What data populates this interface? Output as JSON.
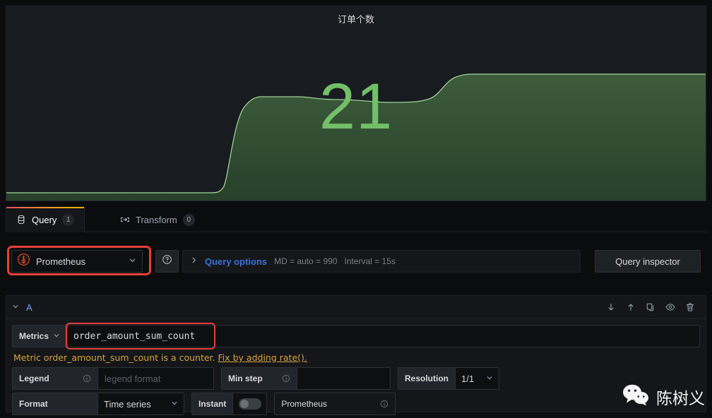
{
  "panel": {
    "title": "订单个数",
    "stat_value": "21",
    "value_color": "#73bf69",
    "line_color": "#8fd48a",
    "fill_color": "#2d4a2c"
  },
  "chart_data": {
    "type": "area",
    "title": "订单个数",
    "xlabel": "",
    "ylabel": "",
    "grid": false,
    "legend": "none",
    "x": [
      0,
      5,
      10,
      15,
      20,
      25,
      29,
      31,
      33,
      35,
      40,
      45,
      50,
      55,
      58,
      60,
      62,
      64,
      66,
      70,
      75,
      80,
      85,
      90,
      95,
      100
    ],
    "values": [
      1,
      1,
      1,
      1,
      1,
      1,
      1,
      3,
      9,
      14,
      15,
      15,
      15,
      15,
      14.6,
      14.4,
      15,
      18,
      21,
      21,
      21,
      21,
      21,
      21,
      21,
      21
    ],
    "ylim": [
      0,
      24
    ],
    "annotations": [
      "21"
    ]
  },
  "tabs": [
    {
      "label": "Query",
      "badge": "1",
      "icon": "database-icon",
      "active": true
    },
    {
      "label": "Transform",
      "badge": "0",
      "icon": "transform-icon",
      "active": false
    }
  ],
  "datasource": {
    "name": "Prometheus",
    "icon": "prometheus-icon",
    "highlighted": true,
    "highlight_color": "#e8403a",
    "help_icon": "question-circle-icon"
  },
  "query_options": {
    "chevron": "chevron-right-icon",
    "title": "Query options",
    "max_data_points": "MD = auto = 990",
    "interval": "Interval = 15s"
  },
  "query_inspector": {
    "label": "Query inspector"
  },
  "query_row": {
    "ref_id": "A",
    "collapse_icon": "chevron-down-icon",
    "actions": [
      {
        "name": "move-down-icon",
        "glyph": "↓"
      },
      {
        "name": "move-up-icon",
        "glyph": "↑"
      },
      {
        "name": "duplicate-icon",
        "glyph": "copy"
      },
      {
        "name": "hide-response-icon",
        "glyph": "eye"
      },
      {
        "name": "remove-query-icon",
        "glyph": "trash"
      }
    ]
  },
  "metrics_row": {
    "label": "Metrics",
    "value": "order_amount_sum_count",
    "highlighted": true
  },
  "warning": {
    "text": "Metric order_amount_sum_count is a counter.",
    "link": "Fix by adding rate().",
    "color": "#d9a441"
  },
  "legend_row": {
    "legend_label": "Legend",
    "legend_placeholder": "legend format",
    "legend_value": "",
    "min_step_label": "Min step",
    "min_step_value": "",
    "resolution_label": "Resolution",
    "resolution_value": "1/1"
  },
  "format_row": {
    "format_label": "Format",
    "format_value": "Time series",
    "instant_label": "Instant",
    "instant_on": false,
    "exemplars_label": "Prometheus"
  },
  "watermark": {
    "text": "陈树义",
    "icon": "wechat-icon"
  }
}
